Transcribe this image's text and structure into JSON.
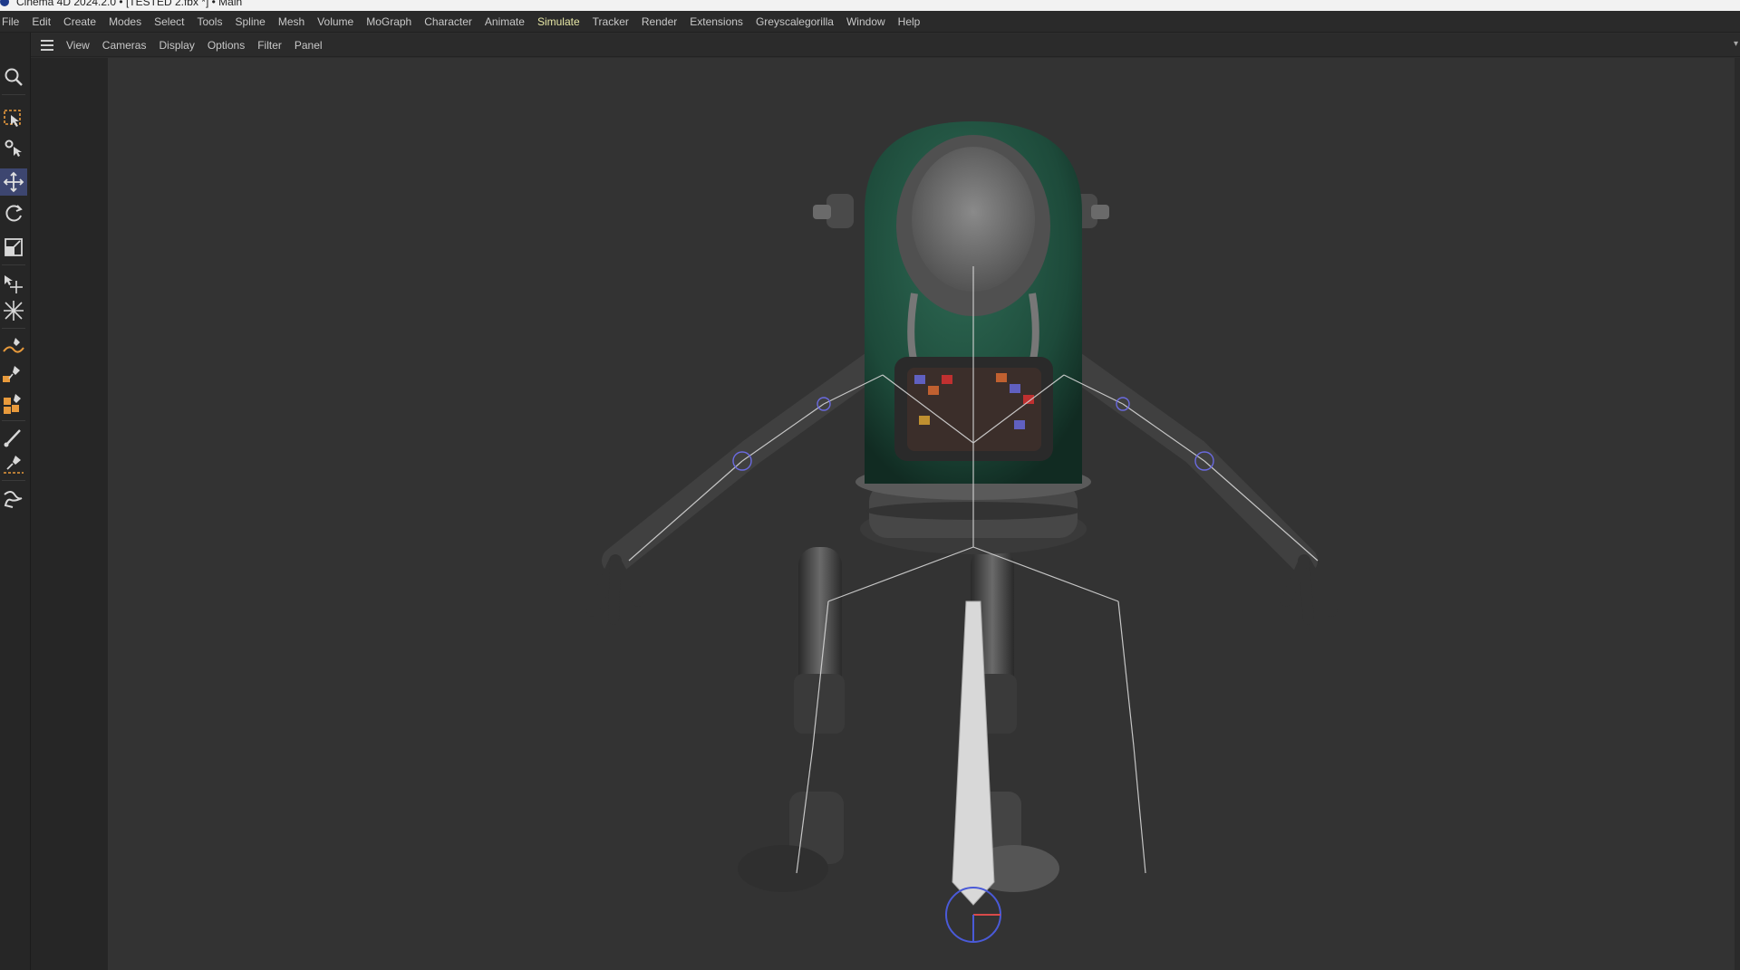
{
  "window": {
    "title": "Cinema 4D 2024.2.0 • [TESTED 2.fbx *] • Main"
  },
  "menubar": {
    "items": [
      "File",
      "Edit",
      "Create",
      "Modes",
      "Select",
      "Tools",
      "Spline",
      "Mesh",
      "Volume",
      "MoGraph",
      "Character",
      "Animate",
      "Simulate",
      "Tracker",
      "Render",
      "Extensions",
      "Greyscalegorilla",
      "Window",
      "Help"
    ],
    "active": "Simulate"
  },
  "viewport_menu": {
    "items": [
      "View",
      "Cameras",
      "Display",
      "Options",
      "Filter",
      "Panel"
    ]
  },
  "toolbar": {
    "tools": [
      {
        "name": "search-icon"
      },
      {
        "name": "rectangle-selection-icon"
      },
      {
        "name": "live-selection-icon"
      },
      {
        "name": "move-icon",
        "selected": true
      },
      {
        "name": "rotate-icon"
      },
      {
        "name": "scale-icon"
      },
      {
        "name": "move-object-icon"
      },
      {
        "name": "scale-object-icon"
      },
      {
        "name": "spline-pen-icon"
      },
      {
        "name": "sketch-icon"
      },
      {
        "name": "polygon-pen-icon"
      },
      {
        "name": "brush-icon"
      },
      {
        "name": "knife-icon"
      },
      {
        "name": "joint-tool-icon"
      }
    ]
  },
  "colors": {
    "accent": "#4a5a9c",
    "robot_body": "#1f4d3c",
    "joint": "#cfcfcf",
    "active_menu": "#e7e7a6"
  }
}
